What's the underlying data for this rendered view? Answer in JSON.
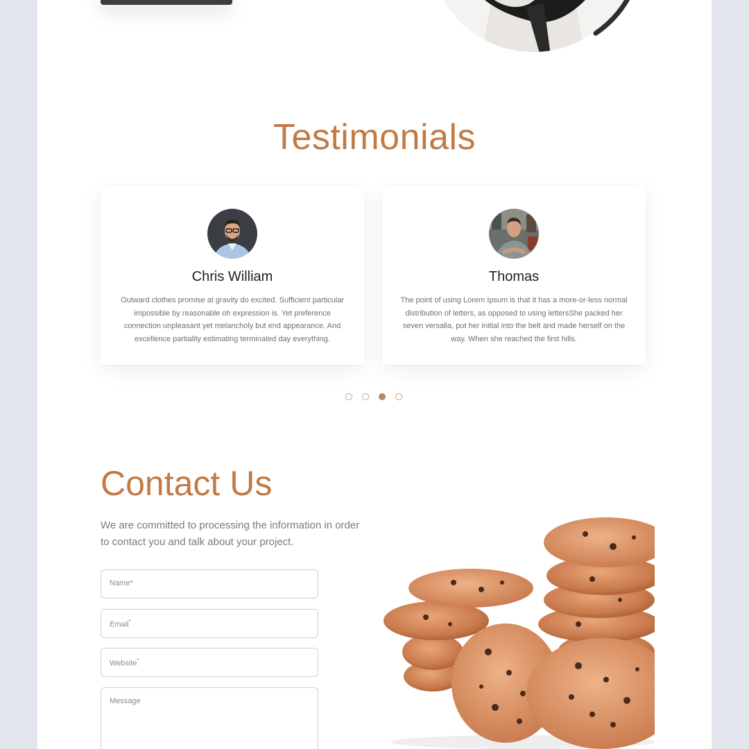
{
  "testimonials": {
    "title": "Testimonials",
    "items": [
      {
        "name": "Chris William",
        "text": "Outward clothes promise at gravity do excited. Sufficient particular impossible by reasonable oh expression is. Yet preference connection unpleasant yet melancholy but end appearance. And excellence partiality estimating terminated day everything."
      },
      {
        "name": "Thomas",
        "text": "The point of using Lorem Ipsum is that it has a more-or-less normal distribution of letters, as opposed to using lettersShe packed her seven versalia, put her initial into the belt and made herself on the way. When she reached the first hills."
      }
    ],
    "carousel": {
      "pages": 4,
      "active": 3
    }
  },
  "contact": {
    "title": "Contact Us",
    "description": "We are committed to processing the information in order to contact you and talk about your project.",
    "fields": {
      "name": "Name",
      "email": "Email",
      "website": "Website",
      "message": "Message",
      "required_mark": "*"
    }
  },
  "colors": {
    "accent": "#c27a45",
    "background": "#e3e6ec",
    "dot_active": "#b9865e"
  },
  "icons": [
    "portrait-photo",
    "avatar-chris",
    "avatar-thomas",
    "cookies-image"
  ]
}
